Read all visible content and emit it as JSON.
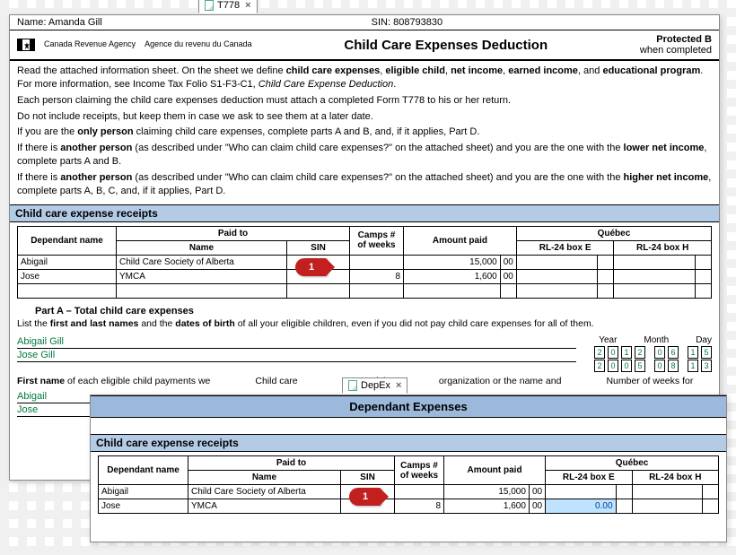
{
  "main": {
    "tab_label": "T778",
    "name_label": "Name:",
    "name_value": "Amanda Gill",
    "sin_label": "SIN:",
    "sin_value": "808793830",
    "agency_en": "Canada Revenue Agency",
    "agency_fr": "Agence du revenu du Canada",
    "form_title": "Child Care Expenses Deduction",
    "protected_label": "Protected B",
    "protected_sub": "when completed",
    "intro": {
      "p1a": "Read the attached information sheet. On the sheet we define ",
      "b1": "child care expenses",
      "p1b": ", ",
      "b2": "eligible child",
      "p1c": ", ",
      "b3": "net income",
      "p1d": ", ",
      "b4": "earned income",
      "p1e": ", and ",
      "b5": "educational program",
      "p1f": ". For more information, see Income Tax Folio S1-F3-C1, ",
      "i1": "Child Care Expense Deduction",
      "p1g": ".",
      "p2": "Each person claiming the child care expenses deduction must attach a completed Form T778 to his or her return.",
      "p3": "Do not include receipts, but keep them in case we ask to see them at a later date.",
      "p4a": "If you are the ",
      "b6": "only person",
      "p4b": " claiming child care expenses, complete parts A and B, and, if it applies, Part D.",
      "p5a": "If there is ",
      "b7": "another person",
      "p5b": " (as described under \"Who can claim child care expenses?\" on the attached sheet) and you are the one with the ",
      "b8": "lower net income",
      "p5c": ", complete parts A and B.",
      "p6a": "If there is ",
      "b9": "another person",
      "p6b": " (as described under \"Who can claim child care expenses?\" on the attached sheet) and you are the one with the ",
      "b10": "higher net income",
      "p6c": ", complete parts A, B, C, and, if it applies, Part D."
    },
    "receipts_title": "Child care expense receipts",
    "cols": {
      "dependant": "Dependant name",
      "paid_to": "Paid to",
      "name": "Name",
      "sin": "SIN",
      "camps": "Camps # of weeks",
      "amount": "Amount paid",
      "quebec": "Québec",
      "rl24e": "RL-24 box E",
      "rl24h": "RL-24 box H"
    },
    "rows": [
      {
        "dependant": "Abigail",
        "payee": "Child Care Society of Alberta",
        "sin": "",
        "camps": "",
        "amount": "15,000",
        "cents": "00",
        "e": "",
        "h": ""
      },
      {
        "dependant": "Jose",
        "payee": "YMCA",
        "sin": "",
        "camps": "8",
        "amount": "1,600",
        "cents": "00",
        "e": "",
        "h": ""
      }
    ],
    "marker1": "1",
    "part_a_title": "Part A – Total child care expenses",
    "part_a_desc1": "List the ",
    "part_a_b1": "first and last names",
    "part_a_desc2": " and the ",
    "part_a_b2": "dates of birth",
    "part_a_desc3": " of all your eligible children, even if you did not pay child care expenses for all of them.",
    "children": [
      {
        "name": "Abigail Gill",
        "dob": [
          "2",
          "0",
          "1",
          "2",
          "0",
          "6",
          "1",
          "5"
        ]
      },
      {
        "name": "Jose Gill",
        "dob": [
          "2",
          "0",
          "0",
          "5",
          "0",
          "8",
          "1",
          "3"
        ]
      }
    ],
    "dob_hdr": {
      "year": "Year",
      "month": "Month",
      "day": "Day"
    },
    "fn_row": {
      "c1a": "First name",
      "c1b": " of each eligible child payments we",
      "c2": "Child care",
      "c3": "Name of the",
      "c4": "organization or the name and",
      "c5": "Number of weeks for"
    },
    "first_names": [
      "Abigail",
      "Jose"
    ]
  },
  "sub": {
    "tab_label": "DepEx",
    "title": "Dependant Expenses",
    "receipts_title": "Child care expense receipts",
    "rows": [
      {
        "dependant": "Abigail",
        "payee": "Child Care Society of Alberta",
        "sin": "",
        "camps": "",
        "amount": "15,000",
        "cents": "00",
        "e": "",
        "h": ""
      },
      {
        "dependant": "Jose",
        "payee": "YMCA",
        "sin": "",
        "camps": "8",
        "amount": "1,600",
        "cents": "00",
        "e": "0.00",
        "h": ""
      }
    ],
    "marker1": "1"
  }
}
